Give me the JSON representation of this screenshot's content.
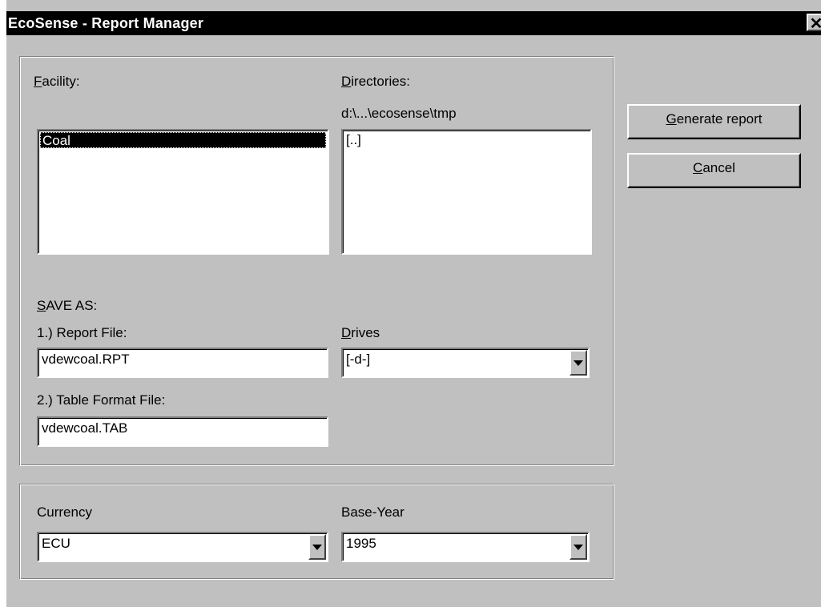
{
  "window": {
    "title": "EcoSense - Report Manager",
    "close_label": "✕"
  },
  "facility": {
    "label_accel": "F",
    "label_rest": "acility:",
    "items": [
      "Coal"
    ]
  },
  "directories": {
    "label_accel": "D",
    "label_rest": "irectories:",
    "path": "d:\\...\\ecosense\\tmp",
    "items": [
      "[..]"
    ]
  },
  "save_as": {
    "label_accel": "S",
    "label_rest": "AVE AS:",
    "report_file_label": "1.) Report File:",
    "report_file_value": "vdewcoal.RPT",
    "table_file_label": "2.) Table Format File:",
    "table_file_value": "vdewcoal.TAB"
  },
  "drives": {
    "label_accel": "D",
    "label_rest": "rives",
    "value": "[-d-]"
  },
  "currency": {
    "label": "Currency",
    "value": "ECU"
  },
  "base_year": {
    "label": "Base-Year",
    "value": "1995"
  },
  "buttons": {
    "generate_accel": "G",
    "generate_rest": "enerate report",
    "cancel_accel": "C",
    "cancel_rest": "ancel"
  }
}
